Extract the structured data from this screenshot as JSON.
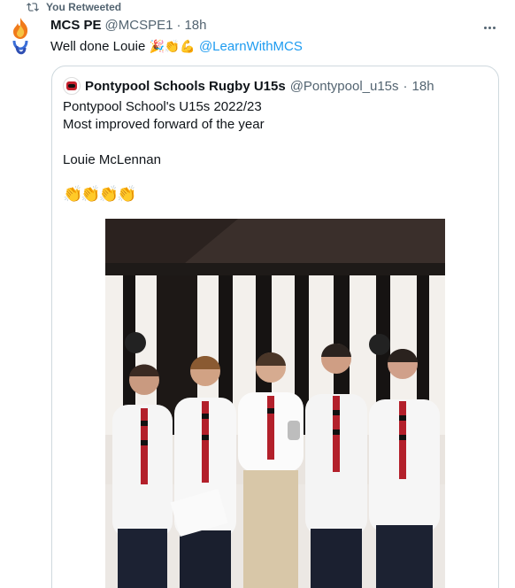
{
  "retweet": {
    "label": "You Retweeted"
  },
  "tweet": {
    "display_name": "MCS PE",
    "handle": "@MCSPE1",
    "separator": "·",
    "time": "18h",
    "text_prefix": "Well done Louie",
    "emojis": "🎉👏💪",
    "mention": "@LearnWithMCS"
  },
  "quote": {
    "display_name": "Pontypool Schools Rugby U15s",
    "handle": "@Pontypool_u15s",
    "separator": "·",
    "time": "18h",
    "lines": [
      "Pontypool School's U15s 2022/23",
      "Most improved forward of the year",
      "Louie McLennan"
    ],
    "claps": "👏👏👏👏"
  },
  "colors": {
    "accent": "#1d9bf0",
    "text_secondary": "#536471",
    "border": "#cfd9de"
  },
  "icons": [
    "retweet-icon",
    "flame-avatar-icon",
    "more-icon"
  ]
}
